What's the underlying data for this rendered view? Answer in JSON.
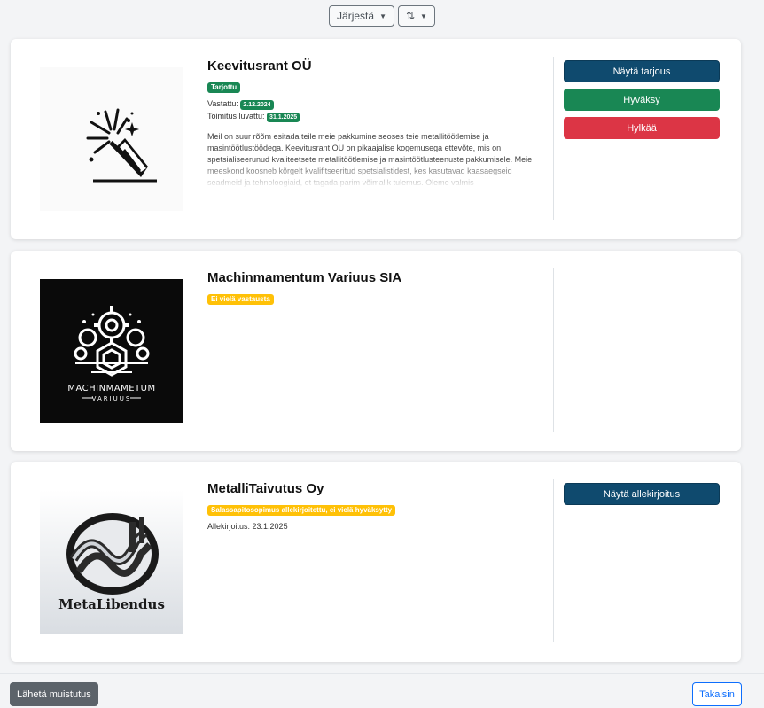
{
  "toolbar": {
    "sort_label": "Järjestä",
    "order_icon": "sort-arrows-icon"
  },
  "cards": [
    {
      "company": "Keevitusrant OÜ",
      "status_badge": "Tarjottu",
      "replied_label": "Vastattu:",
      "replied_date": "2.12.2024",
      "delivery_label": "Toimitus luvattu:",
      "delivery_date": "31.1.2025",
      "description": "Meil on suur rõõm esitada teile meie pakkumine seoses teie metallitöötlemise ja masintöötlustöödega. Keevitusrant OÜ on pikaajalise kogemusega ettevõte, mis on spetsialiseerunud kvaliteetsete metallitöötlemise ja masintöötlusteenuste pakkumisele. Meie meeskond koosneb kõrgelt kvalifitseeritud spetsialistidest, kes kasutavad kaasaegseid seadmeid ja tehnoloogiaid, et tagada parim võimalik tulemus. Oleme valmis",
      "buttons": [
        "Näytä tarjous",
        "Hyväksy",
        "Hylkää"
      ],
      "logo_icon": "welding-torch-icon"
    },
    {
      "company": "Machinmamentum Variuus SIA",
      "status_badge": "Ei vielä vastausta",
      "logo_text": "MACHINMAMETUM",
      "logo_subtext": "VARIUUS",
      "logo_icon": "gears-logo-icon"
    },
    {
      "company": "MetalliTaivutus Oy",
      "status_badge": "Salassapitosopimus allekirjoitettu, ei vielä hyväksytty",
      "signed_label": "Allekirjoitus:",
      "signed_date": "23.1.2025",
      "buttons": [
        "Näytä allekirjoitus"
      ],
      "logo_text": "MetaLibendus",
      "logo_icon": "metal-bend-logo-icon"
    }
  ],
  "footer": {
    "reminder_button": "Lähetä muistutus",
    "back_button": "Takaisin"
  },
  "colors": {
    "navy": "#0f4a6e",
    "green": "#198754",
    "red": "#dc3545",
    "yellow": "#ffc107"
  }
}
